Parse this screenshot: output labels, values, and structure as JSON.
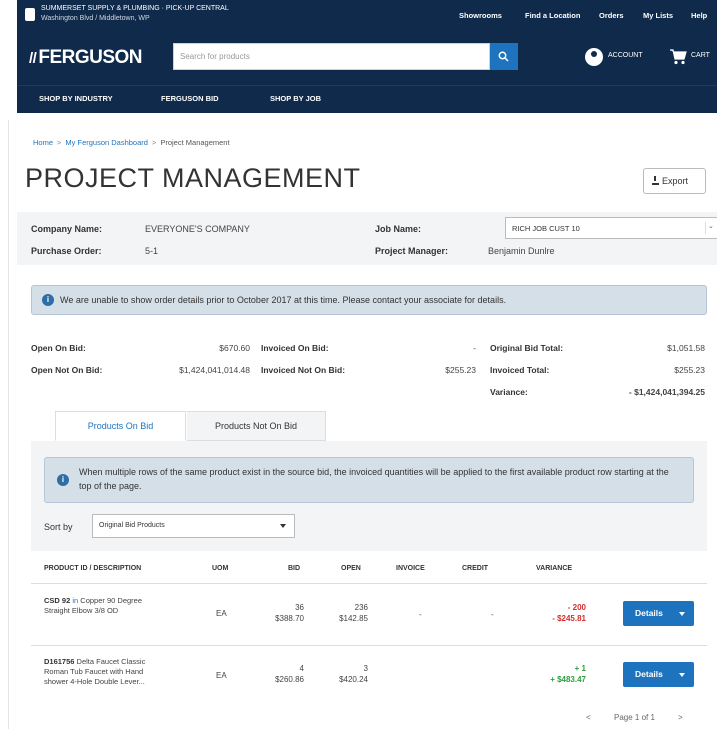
{
  "topbar": {
    "location_line1": "SUMMERSET SUPPLY & PLUMBING · PICK-UP CENTRAL",
    "location_line2": "Washington Blvd / Middletown, WP",
    "links": [
      "Showrooms",
      "Find a Location",
      "Orders",
      "My Lists",
      "Help"
    ]
  },
  "header": {
    "logo": "FERGUSON",
    "search_placeholder": "Search for products",
    "account_label": "ACCOUNT",
    "cart_label": "CART"
  },
  "nav": [
    "SHOP BY INDUSTRY",
    "FERGUSON BID",
    "SHOP BY JOB"
  ],
  "breadcrumb": [
    "Home",
    "My Ferguson Dashboard",
    "Project Management"
  ],
  "page": {
    "title": "PROJECT MANAGEMENT",
    "export_label": "Export"
  },
  "info": {
    "company_label": "Company Name:",
    "company_value": "EVERYONE'S COMPANY",
    "po_label": "Purchase Order:",
    "po_value": "5-1",
    "job_label": "Job Name:",
    "job_value": "RICH JOB CUST 10",
    "pm_label": "Project Manager:",
    "pm_value": "Benjamin Dunlre"
  },
  "alert_top": "We are unable to show order details prior to October 2017 at this time. Please contact your associate for details.",
  "stats": {
    "open_on_bid_label": "Open On Bid:",
    "open_on_bid_value": "$670.60",
    "open_not_on_bid_label": "Open Not On Bid:",
    "open_not_on_bid_value": "$1,424,041,014.48",
    "invoiced_on_bid_label": "Invoiced On Bid:",
    "invoiced_on_bid_value": "-",
    "invoiced_not_on_bid_label": "Invoiced Not On Bid:",
    "invoiced_not_on_bid_value": "$255.23",
    "original_bid_total_label": "Original Bid Total:",
    "original_bid_total_value": "$1,051.58",
    "invoiced_total_label": "Invoiced Total:",
    "invoiced_total_value": "$255.23",
    "variance_label": "Variance:",
    "variance_value": "- $1,424,041,394.25"
  },
  "tabs": [
    "Products On Bid",
    "Products Not On Bid"
  ],
  "alert_bid": "When multiple rows of the same product exist in the source bid, the invoiced quantities will be applied to the first available product row starting at the top of the page.",
  "sort": {
    "label": "Sort by",
    "value": "Original Bid Products"
  },
  "table": {
    "headers": [
      "PRODUCT ID / DESCRIPTION",
      "UOM",
      "BID",
      "OPEN",
      "INVOICE",
      "CREDIT",
      "VARIANCE"
    ],
    "rows": [
      {
        "pid": "CSD 92",
        "sep": "in",
        "desc1": "Copper 90 Degree",
        "desc2": "Straight Elbow 3/8 OD",
        "uom": "EA",
        "bid_qty": "36",
        "bid_amt": "$388.70",
        "open_qty": "236",
        "open_amt": "$142.85",
        "invoice": "-",
        "credit": "-",
        "var_qty": "- 200",
        "var_amt": "- $245.81",
        "var_tone": "red",
        "details": "Details"
      },
      {
        "pid": "D161756",
        "sep": "",
        "desc1": "Delta Faucet Classic",
        "desc2": "Roman Tub Faucet with Hand",
        "desc3": "shower 4-Hole Double Lever...",
        "uom": "EA",
        "bid_qty": "4",
        "bid_amt": "$260.86",
        "open_qty": "3",
        "open_amt": "$420.24",
        "invoice": "",
        "credit": "",
        "var_qty": "+ 1",
        "var_amt": "+ $483.47",
        "var_tone": "green",
        "details": "Details"
      }
    ]
  },
  "pager": {
    "prev": "<",
    "label": "Page 1 of 1",
    "next": ">"
  }
}
